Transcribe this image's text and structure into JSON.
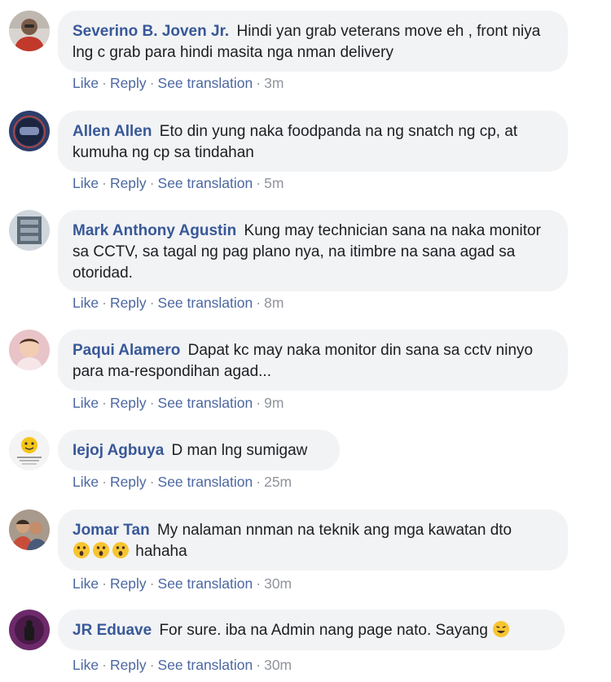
{
  "comments": [
    {
      "author": "Severino B. Joven Jr.",
      "text": "Hindi yan grab veterans move eh , front niya lng c grab para hindi masita nga nman delivery",
      "like": "Like",
      "reply": "Reply",
      "translate": "See translation",
      "time": "3m",
      "avatar_icon": "person-in-red-shirt-avatar"
    },
    {
      "author": "Allen Allen",
      "text": "Eto din yung naka foodpanda na ng snatch ng cp, at kumuha ng cp sa tindahan",
      "like": "Like",
      "reply": "Reply",
      "translate": "See translation",
      "time": "5m",
      "avatar_icon": "helmet-avatar"
    },
    {
      "author": "Mark Anthony Agustin",
      "text": "Kung may technician sana na naka monitor sa CCTV, sa tagal ng pag plano nya, na itimbre na sana agad sa otoridad.",
      "like": "Like",
      "reply": "Reply",
      "translate": "See translation",
      "time": "8m",
      "avatar_icon": "equipment-avatar"
    },
    {
      "author": "Paqui Alamero",
      "text": "Dapat kc may naka monitor din sana sa cctv ninyo para ma-respondihan agad...",
      "like": "Like",
      "reply": "Reply",
      "translate": "See translation",
      "time": "9m",
      "avatar_icon": "baby-photo-avatar"
    },
    {
      "author": "Iejoj Agbuya",
      "text": "D man lng sumigaw",
      "like": "Like",
      "reply": "Reply",
      "translate": "See translation",
      "time": "25m",
      "avatar_icon": "emoji-logo-avatar"
    },
    {
      "author": "Jomar Tan",
      "text": "My nalaman nnman na teknik ang mga kawatan dto",
      "emoji_text": "hahaha",
      "like": "Like",
      "reply": "Reply",
      "translate": "See translation",
      "time": "30m",
      "avatar_icon": "group-photo-avatar"
    },
    {
      "author": "JR Eduave",
      "text": "For sure. iba na Admin nang page nato. Sayang",
      "like": "Like",
      "reply": "Reply",
      "translate": "See translation",
      "time": "30m",
      "avatar_icon": "purple-figure-avatar"
    }
  ],
  "colors": {
    "author": "#385898",
    "bubble": "#f2f3f5",
    "action_link": "#4b67a1",
    "meta": "#90949c"
  }
}
